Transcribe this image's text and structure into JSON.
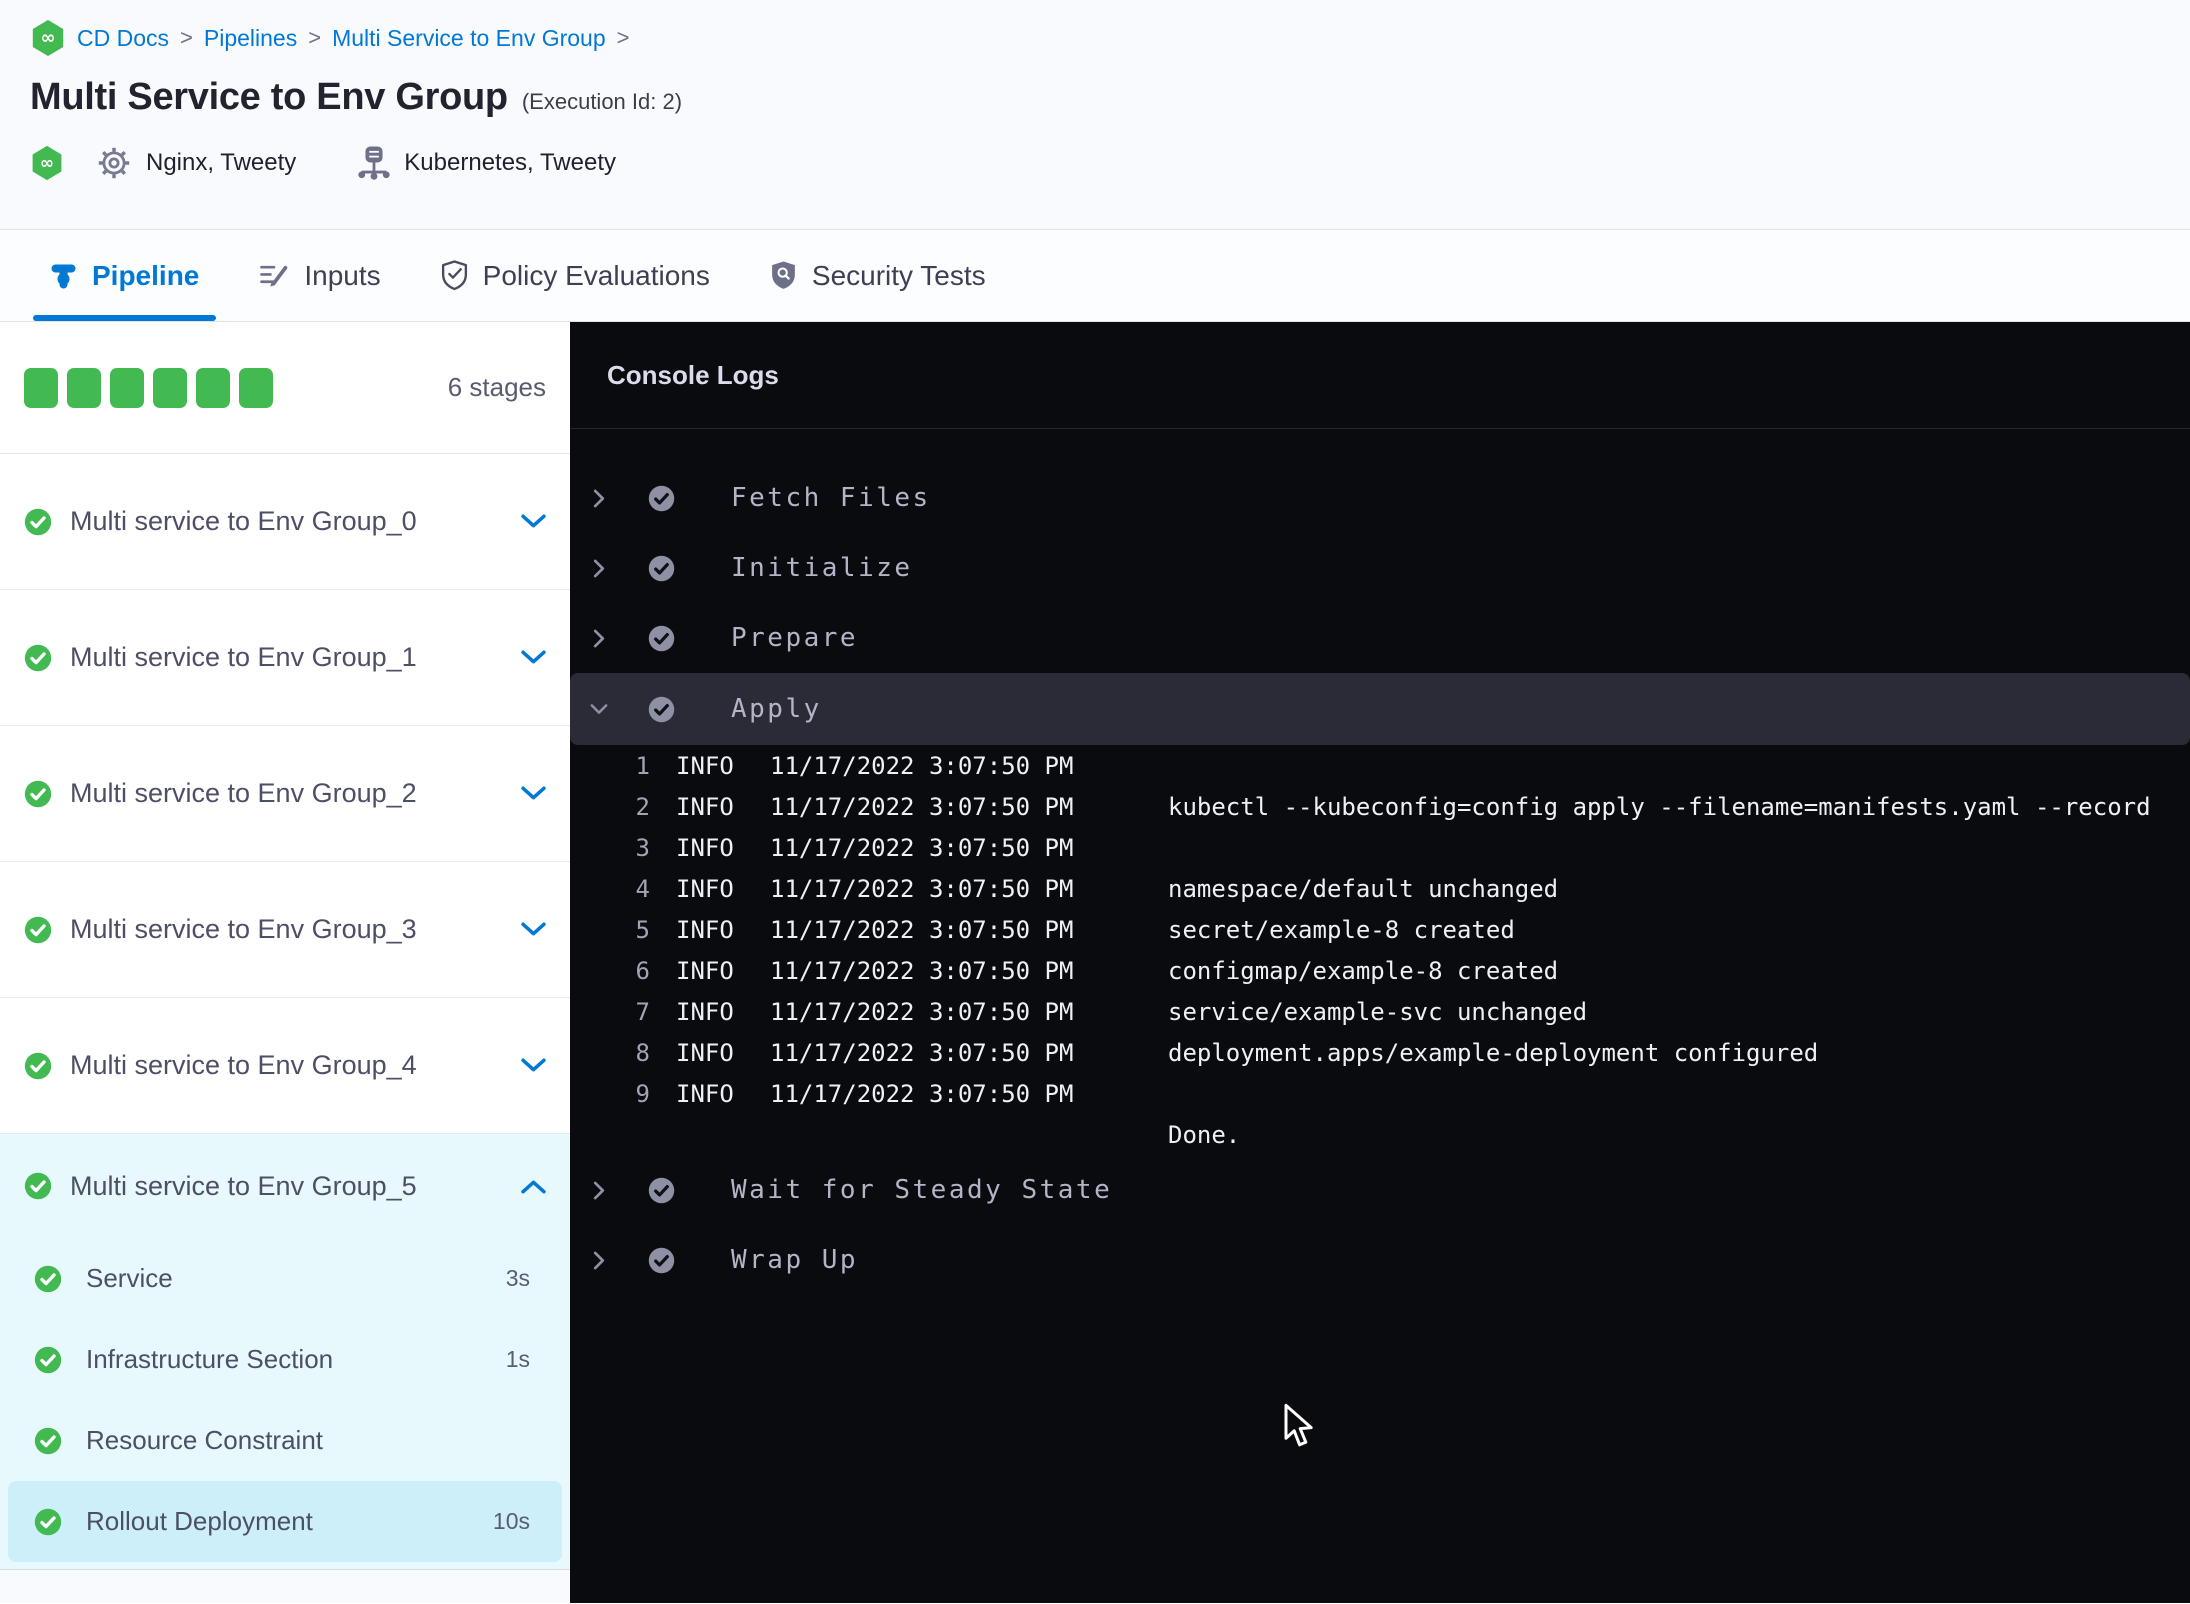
{
  "colors": {
    "primary_blue": "#0278d5",
    "success_green": "#42ba51",
    "console_bg": "#0a0b0f",
    "expanded_stage_bg": "#e7f9fd",
    "selected_step_bg": "#cceffa",
    "open_console_step_bg": "#2a2b36"
  },
  "breadcrumb": {
    "separator": ">",
    "items": [
      "CD Docs",
      "Pipelines",
      "Multi Service to Env Group"
    ]
  },
  "header": {
    "title": "Multi Service to Env Group",
    "execution_id": "(Execution Id: 2)",
    "services": "Nginx, Tweety",
    "infrastructure": "Kubernetes, Tweety"
  },
  "tabs": [
    {
      "label": "Pipeline",
      "icon": "pipeline-icon",
      "active": true
    },
    {
      "label": "Inputs",
      "icon": "inputs-icon",
      "active": false
    },
    {
      "label": "Policy Evaluations",
      "icon": "policy-evaluations-icon",
      "active": false
    },
    {
      "label": "Security Tests",
      "icon": "security-tests-icon",
      "active": false
    }
  ],
  "sidebar": {
    "stage_count": 6,
    "stage_count_label": "6 stages",
    "stages": [
      {
        "label": "Multi service to Env Group_0",
        "status": "success",
        "expanded": false
      },
      {
        "label": "Multi service to Env Group_1",
        "status": "success",
        "expanded": false
      },
      {
        "label": "Multi service to Env Group_2",
        "status": "success",
        "expanded": false
      },
      {
        "label": "Multi service to Env Group_3",
        "status": "success",
        "expanded": false
      },
      {
        "label": "Multi service to Env Group_4",
        "status": "success",
        "expanded": false
      },
      {
        "label": "Multi service to Env Group_5",
        "status": "success",
        "expanded": true,
        "steps": [
          {
            "label": "Service",
            "duration": "3s",
            "status": "success",
            "selected": false
          },
          {
            "label": "Infrastructure Section",
            "duration": "1s",
            "status": "success",
            "selected": false
          },
          {
            "label": "Resource Constraint",
            "duration": "",
            "status": "success",
            "selected": false
          },
          {
            "label": "Rollout Deployment",
            "duration": "10s",
            "status": "success",
            "selected": true
          }
        ]
      }
    ]
  },
  "console": {
    "title": "Console Logs",
    "steps": [
      {
        "label": "Fetch Files",
        "status": "success",
        "expanded": false
      },
      {
        "label": "Initialize",
        "status": "success",
        "expanded": false
      },
      {
        "label": "Prepare",
        "status": "success",
        "expanded": false
      },
      {
        "label": "Apply",
        "status": "success",
        "expanded": true,
        "logs": [
          {
            "line": "1",
            "level": "INFO",
            "timestamp": "11/17/2022 3:07:50 PM",
            "message": ""
          },
          {
            "line": "2",
            "level": "INFO",
            "timestamp": "11/17/2022 3:07:50 PM",
            "message": "kubectl --kubeconfig=config apply --filename=manifests.yaml --record"
          },
          {
            "line": "3",
            "level": "INFO",
            "timestamp": "11/17/2022 3:07:50 PM",
            "message": ""
          },
          {
            "line": "4",
            "level": "INFO",
            "timestamp": "11/17/2022 3:07:50 PM",
            "message": "namespace/default unchanged"
          },
          {
            "line": "5",
            "level": "INFO",
            "timestamp": "11/17/2022 3:07:50 PM",
            "message": "secret/example-8 created"
          },
          {
            "line": "6",
            "level": "INFO",
            "timestamp": "11/17/2022 3:07:50 PM",
            "message": "configmap/example-8 created"
          },
          {
            "line": "7",
            "level": "INFO",
            "timestamp": "11/17/2022 3:07:50 PM",
            "message": "service/example-svc unchanged"
          },
          {
            "line": "8",
            "level": "INFO",
            "timestamp": "11/17/2022 3:07:50 PM",
            "message": "deployment.apps/example-deployment configured"
          },
          {
            "line": "9",
            "level": "INFO",
            "timestamp": "11/17/2022 3:07:50 PM",
            "message": ""
          },
          {
            "line": "",
            "level": "",
            "timestamp": "",
            "message": "Done."
          }
        ]
      },
      {
        "label": "Wait for Steady State",
        "status": "success",
        "expanded": false
      },
      {
        "label": "Wrap Up",
        "status": "success",
        "expanded": false
      }
    ]
  }
}
